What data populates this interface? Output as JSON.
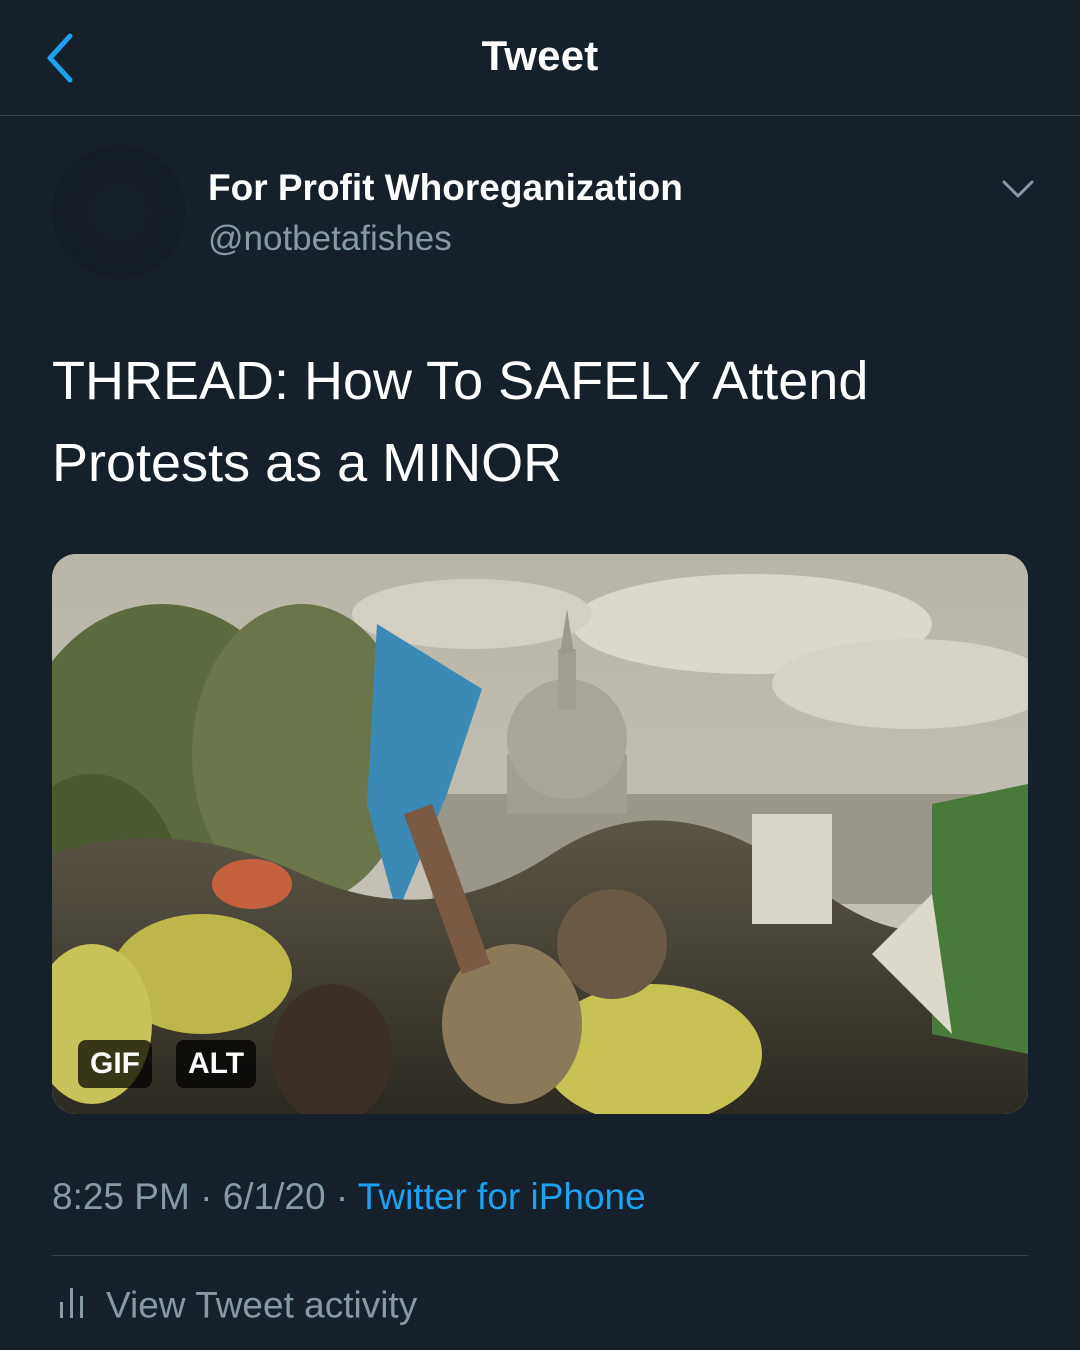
{
  "header": {
    "title": "Tweet"
  },
  "author": {
    "display_name": "For Profit Whoreganization",
    "handle": "@notbetafishes"
  },
  "tweet": {
    "text_line1": "THREAD: How To SAFELY Attend",
    "text_line2": "Protests as a MINOR"
  },
  "media": {
    "badges": [
      "GIF",
      "ALT"
    ]
  },
  "meta": {
    "time": "8:25 PM",
    "separator": "·",
    "date": "6/1/20",
    "source": "Twitter for iPhone"
  },
  "activity": {
    "label": "View Tweet activity"
  },
  "colors": {
    "background": "#15202b",
    "accent": "#1da1f2",
    "secondary_text": "#8899a6",
    "divider": "#38444d"
  }
}
